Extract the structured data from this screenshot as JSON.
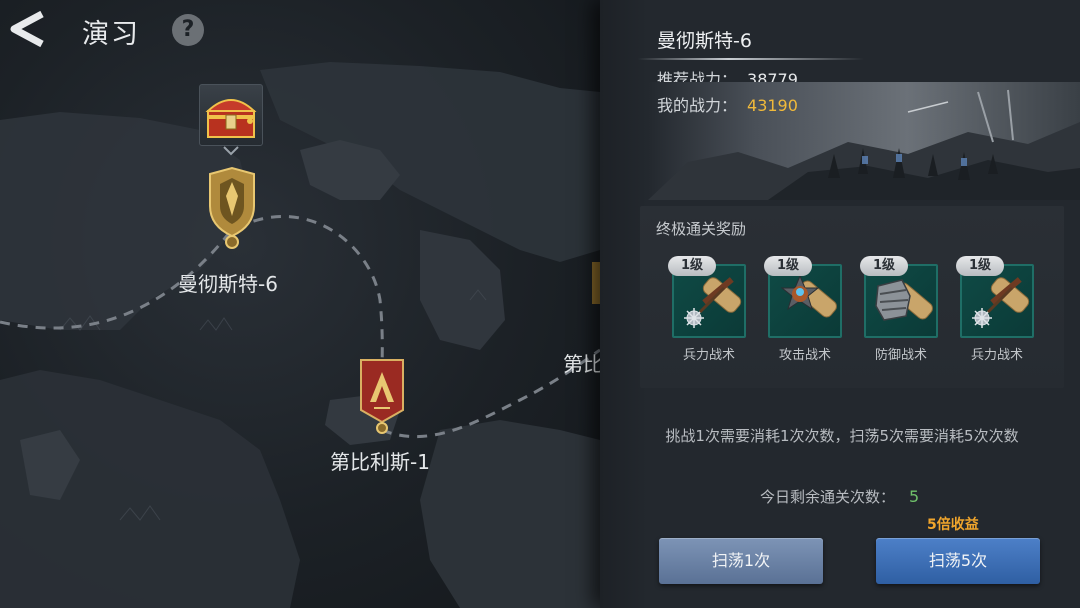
{
  "header": {
    "title": "演习",
    "help_label": "?"
  },
  "map": {
    "nodes": [
      {
        "label": "曼彻斯特-6"
      },
      {
        "label": "第比利斯-1"
      },
      {
        "label": "第比"
      }
    ]
  },
  "stage": {
    "name": "曼彻斯特-6",
    "recommended_power_label": "推荐战力：",
    "recommended_power": "38779",
    "my_power_label": "我的战力：",
    "my_power": "43190"
  },
  "rewards": {
    "title": "终极通关奖励",
    "items": [
      {
        "level": "1级",
        "name": "兵力战术",
        "icon": "mace-scroll-icon"
      },
      {
        "level": "1级",
        "name": "攻击战术",
        "icon": "star-medal-scroll-icon"
      },
      {
        "level": "1级",
        "name": "防御战术",
        "icon": "gauntlet-scroll-icon"
      },
      {
        "level": "1级",
        "name": "兵力战术",
        "icon": "mace-scroll-icon"
      }
    ]
  },
  "consume_note": "挑战1次需要消耗1次次数，扫荡5次需要消耗5次次数",
  "remaining": {
    "label": "今日剩余通关次数：",
    "value": "5"
  },
  "bonus": "5倍收益",
  "buttons": {
    "sweep1": "扫荡1次",
    "sweep5": "扫荡5次"
  },
  "colors": {
    "my_power": "#f0b93a",
    "remaining": "#6fc06a",
    "bonus": "#f0a52c",
    "primary_button": "#3a6db5"
  }
}
